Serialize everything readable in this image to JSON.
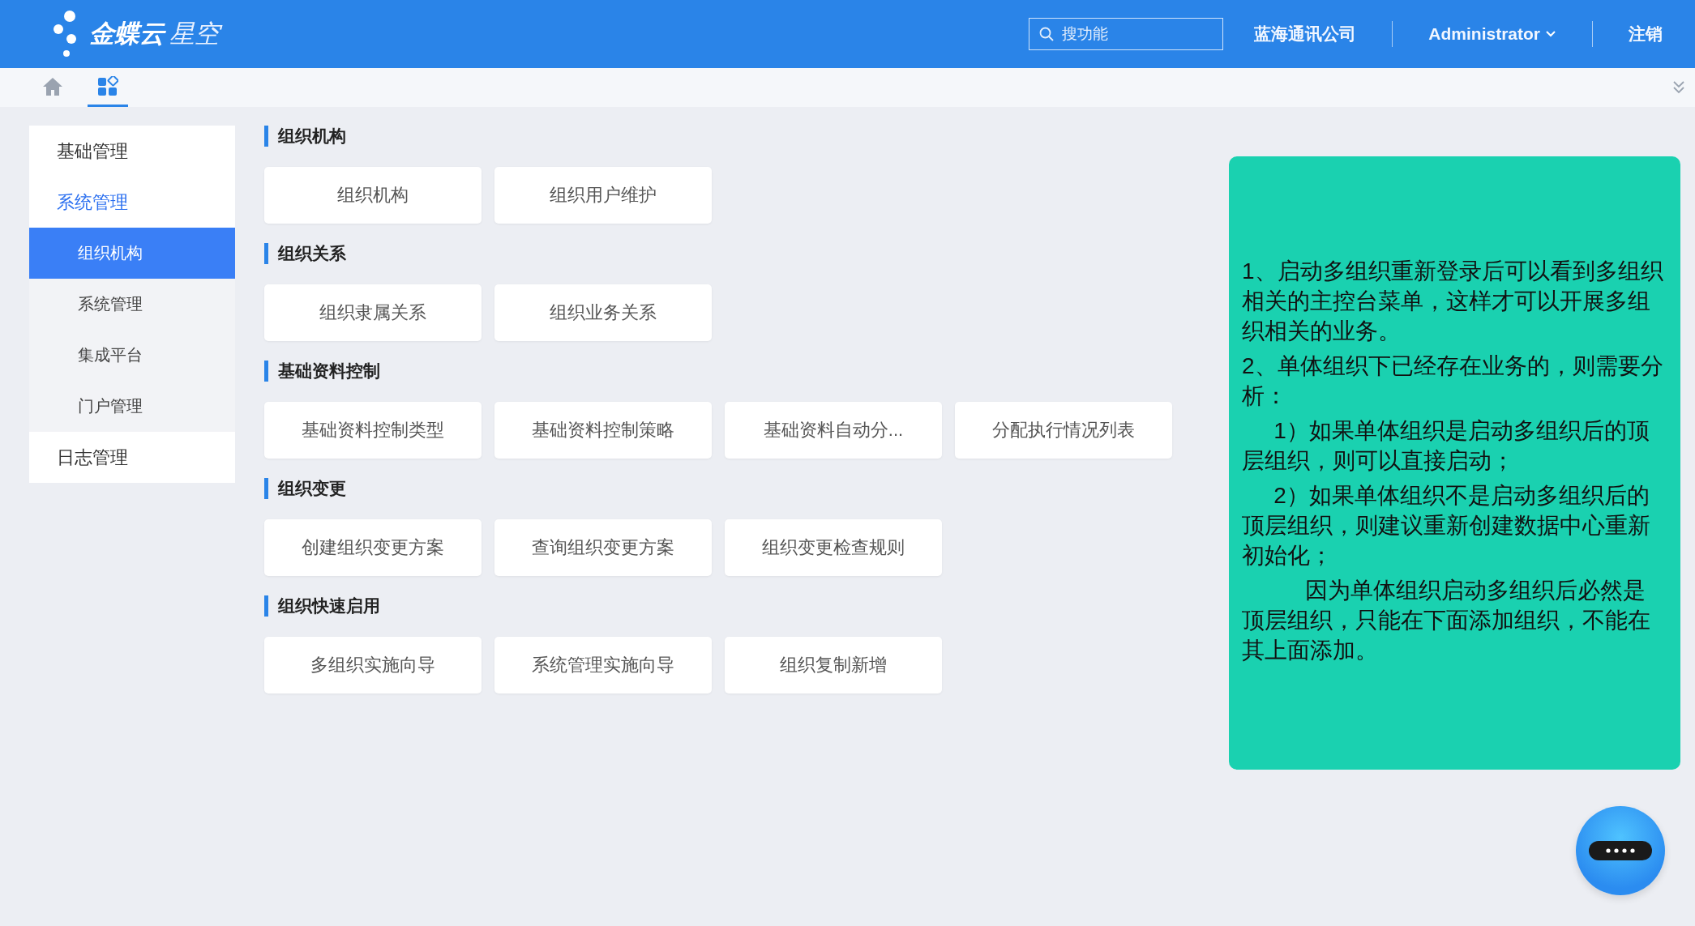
{
  "header": {
    "logo": {
      "brand": "金蝶云",
      "product": "星空"
    },
    "search": {
      "placeholder": "搜功能"
    },
    "company": "蓝海通讯公司",
    "user": "Administrator",
    "logout": "注销"
  },
  "tabs": [
    {
      "kind": "home",
      "selected": false
    },
    {
      "kind": "apps",
      "selected": true
    }
  ],
  "sidebar": {
    "items": [
      {
        "label": "基础管理",
        "expanded": false
      },
      {
        "label": "系统管理",
        "expanded": true,
        "children": [
          {
            "label": "组织机构",
            "selected": true
          },
          {
            "label": "系统管理",
            "selected": false
          },
          {
            "label": "集成平台",
            "selected": false
          },
          {
            "label": "门户管理",
            "selected": false
          }
        ]
      },
      {
        "label": "日志管理",
        "expanded": false
      }
    ]
  },
  "sections": [
    {
      "title": "组织机构",
      "buttons": [
        "组织机构",
        "组织用户维护"
      ]
    },
    {
      "title": "组织关系",
      "buttons": [
        "组织隶属关系",
        "组织业务关系"
      ]
    },
    {
      "title": "基础资料控制",
      "buttons": [
        "基础资料控制类型",
        "基础资料控制策略",
        "基础资料自动分...",
        "分配执行情况列表"
      ]
    },
    {
      "title": "组织变更",
      "buttons": [
        "创建组织变更方案",
        "查询组织变更方案",
        "组织变更检查规则"
      ]
    },
    {
      "title": "组织快速启用",
      "buttons": [
        "多组织实施向导",
        "系统管理实施向导",
        "组织复制新增"
      ]
    }
  ],
  "note": {
    "paragraphs": [
      {
        "kind": "item",
        "text": "1、启动多组织重新登录后可以看到多组织相关的主控台菜单，这样才可以开展多组织相关的业务。"
      },
      {
        "kind": "item",
        "text": "2、单体组织下已经存在业务的，则需要分析："
      },
      {
        "kind": "subitem",
        "text": "1）如果单体组织是启动多组织后的顶层组织，则可以直接启动；"
      },
      {
        "kind": "subitem",
        "text": "2）如果单体组织不是启动多组织后的顶层组织，则建议重新创建数据中心重新初始化；"
      },
      {
        "kind": "remark",
        "text": "因为单体组织启动多组织后必然是顶层组织，只能在下面添加组织，不能在其上面添加。"
      }
    ]
  }
}
